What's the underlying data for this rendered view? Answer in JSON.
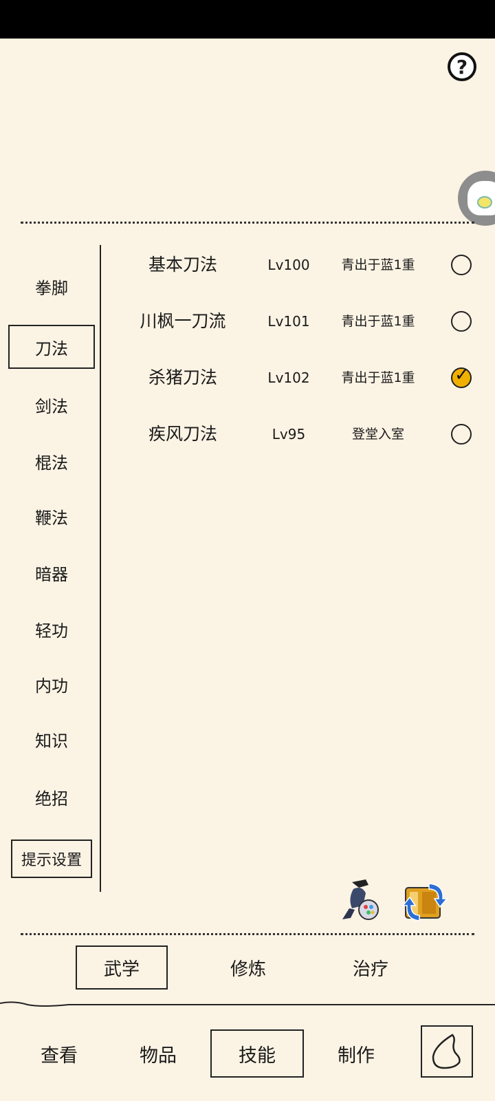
{
  "side_categories": [
    "拳脚",
    "刀法",
    "剑法",
    "棍法",
    "鞭法",
    "暗器",
    "轻功",
    "内功",
    "知识",
    "绝招"
  ],
  "active_category": "刀法",
  "tip_settings_label": "提示设置",
  "skills": [
    {
      "name": "基本刀法",
      "level": "Lv100",
      "grade": "青出于蓝1重",
      "equipped": false
    },
    {
      "name": "川枫一刀流",
      "level": "Lv101",
      "grade": "青出于蓝1重",
      "equipped": false
    },
    {
      "name": "杀猪刀法",
      "level": "Lv102",
      "grade": "青出于蓝1重",
      "equipped": true
    },
    {
      "name": "疾风刀法",
      "level": "Lv95",
      "grade": "登堂入室",
      "equipped": false
    }
  ],
  "sub_tabs": [
    "武学",
    "修炼",
    "治疗"
  ],
  "active_sub_tab": "武学",
  "nav_tabs": [
    "查看",
    "物品",
    "技能",
    "制作"
  ],
  "active_nav_tab": "技能",
  "help_symbol": "?"
}
